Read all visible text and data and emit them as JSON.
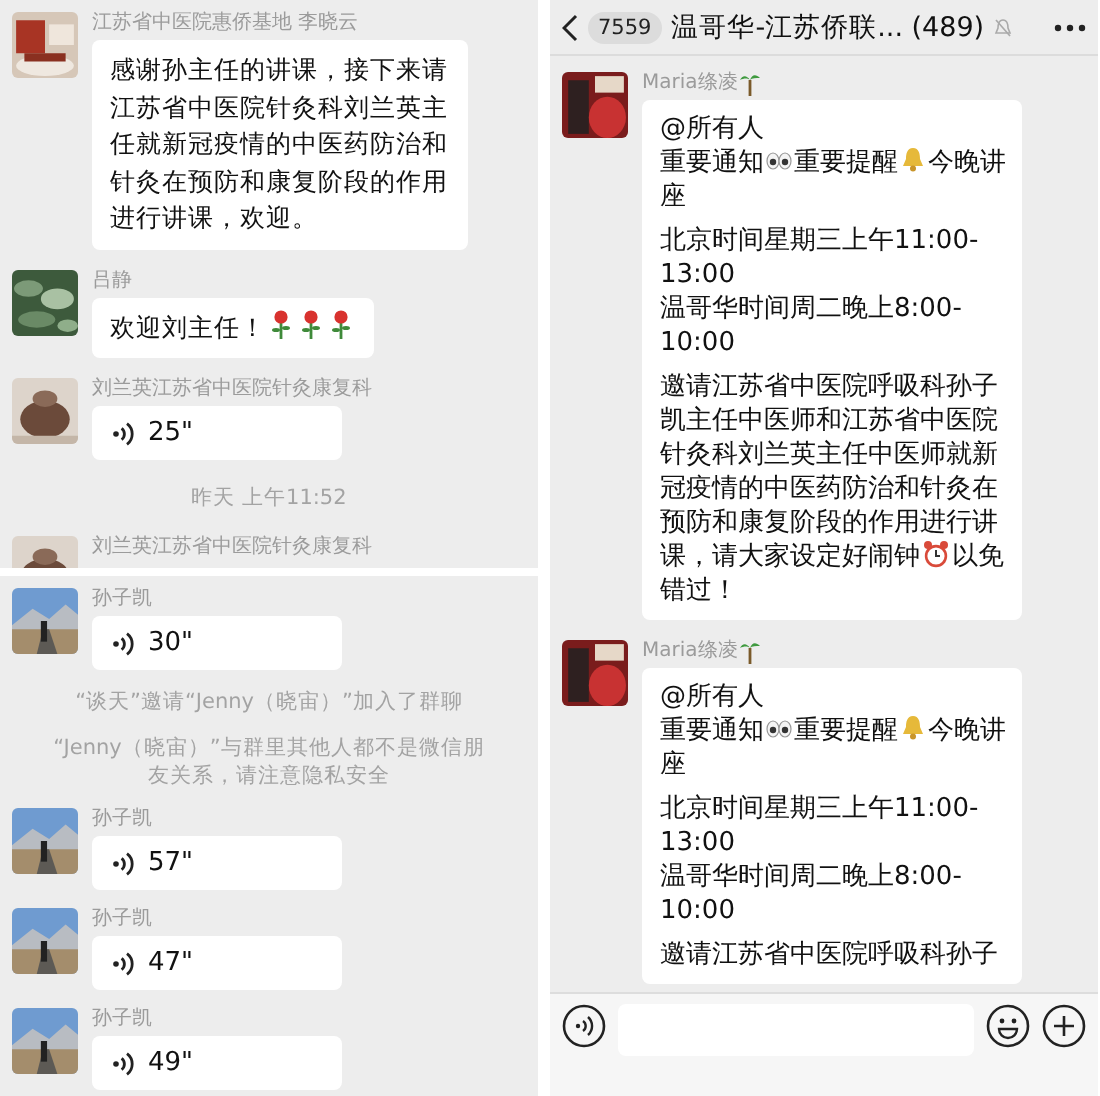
{
  "left_chat": {
    "sections": [
      {
        "items": [
          {
            "kind": "text",
            "sender": "江苏省中医院惠侨基地 李晓云",
            "avatar": {
              "kind": "picture"
            },
            "paragraphs": [
              [
                [
                  {
                    "kind": "text",
                    "text": "感谢孙主任的讲课，接下来请江苏省中医院针灸科刘兰英主任就新冠疫情的中医药防治和针灸在预防和康复阶段的作用进行讲课，欢迎。"
                  }
                ]
              ]
            ]
          },
          {
            "kind": "text",
            "sender": "吕静",
            "avatar": {
              "kind": "picture"
            },
            "paragraphs": [
              [
                [
                  {
                    "kind": "text",
                    "text": "欢迎刘主任！"
                  },
                  {
                    "kind": "rose"
                  },
                  {
                    "kind": "rose"
                  },
                  {
                    "kind": "rose"
                  }
                ]
              ]
            ]
          },
          {
            "kind": "voice",
            "sender": "刘兰英江苏省中医院针灸康复科",
            "avatar": {
              "kind": "picture"
            },
            "duration": "25\""
          },
          {
            "kind": "time",
            "text": "昨天 上午11:52"
          },
          {
            "kind": "cut",
            "sender": "刘兰英江苏省中医院针灸康复科",
            "avatar": {
              "kind": "picture"
            }
          }
        ]
      },
      {
        "items": [
          {
            "kind": "voice",
            "sender": "孙子凯",
            "avatar": {
              "kind": "picture"
            },
            "duration": "30\""
          },
          {
            "kind": "system",
            "text": "“谈天”邀请“Jenny（晓宙）”加入了群聊"
          },
          {
            "kind": "system",
            "text": "“Jenny（晓宙）”与群里其他人都不是微信朋友关系，请注意隐私安全"
          },
          {
            "kind": "voice",
            "sender": "孙子凯",
            "avatar": {
              "kind": "picture"
            },
            "duration": "57\""
          },
          {
            "kind": "voice",
            "sender": "孙子凯",
            "avatar": {
              "kind": "picture"
            },
            "duration": "47\""
          },
          {
            "kind": "voice",
            "sender": "孙子凯",
            "avatar": {
              "kind": "picture"
            },
            "duration": "49\""
          }
        ]
      }
    ]
  },
  "right_chat": {
    "header": {
      "unread": "7559",
      "title": "温哥华-江苏侨联... (489)",
      "muted": true
    },
    "messages": [
      {
        "kind": "text",
        "sender": "Maria绦凌",
        "sender_icon": {
          "kind": "palm"
        },
        "avatar": {
          "kind": "picture"
        },
        "paragraphs": [
          [
            [
              {
                "kind": "text",
                "text": "@所有人"
              }
            ],
            [
              {
                "kind": "text",
                "text": "重要通知"
              },
              {
                "kind": "eyes"
              },
              {
                "kind": "text",
                "text": "重要提醒"
              },
              {
                "kind": "bell"
              },
              {
                "kind": "text",
                "text": "今晚讲"
              }
            ],
            [
              {
                "kind": "text",
                "text": "座"
              }
            ]
          ],
          [
            [
              {
                "kind": "text",
                "text": "北京时间星期三上午11:00-"
              }
            ],
            [
              {
                "kind": "text",
                "text": "13:00"
              }
            ],
            [
              {
                "kind": "text",
                "text": "温哥华时间周二晚上8:00-"
              }
            ],
            [
              {
                "kind": "text",
                "text": "10:00"
              }
            ]
          ],
          [
            [
              {
                "kind": "text",
                "text": "邀请江苏省中医院呼吸科孙子"
              }
            ],
            [
              {
                "kind": "text",
                "text": "凯主任中医师和江苏省中医院"
              }
            ],
            [
              {
                "kind": "text",
                "text": "针灸科刘兰英主任中医师就新"
              }
            ],
            [
              {
                "kind": "text",
                "text": "冠疫情的中医药防治和针灸在"
              }
            ],
            [
              {
                "kind": "text",
                "text": "预防和康复阶段的作用进行讲"
              }
            ],
            [
              {
                "kind": "text",
                "text": "课，请大家设定好闹钟"
              },
              {
                "kind": "clock"
              },
              {
                "kind": "text",
                "text": "以免"
              }
            ],
            [
              {
                "kind": "text",
                "text": "错过！"
              }
            ]
          ]
        ]
      },
      {
        "kind": "text",
        "sender": "Maria绦凌",
        "sender_icon": {
          "kind": "palm"
        },
        "avatar": {
          "kind": "picture"
        },
        "paragraphs": [
          [
            [
              {
                "kind": "text",
                "text": "@所有人"
              }
            ],
            [
              {
                "kind": "text",
                "text": "重要通知"
              },
              {
                "kind": "eyes"
              },
              {
                "kind": "text",
                "text": "重要提醒"
              },
              {
                "kind": "bell"
              },
              {
                "kind": "text",
                "text": "今晚讲"
              }
            ],
            [
              {
                "kind": "text",
                "text": "座"
              }
            ]
          ],
          [
            [
              {
                "kind": "text",
                "text": "北京时间星期三上午11:00-"
              }
            ],
            [
              {
                "kind": "text",
                "text": "13:00"
              }
            ],
            [
              {
                "kind": "text",
                "text": "温哥华时间周二晚上8:00-"
              }
            ],
            [
              {
                "kind": "text",
                "text": "10:00"
              }
            ]
          ],
          [
            [
              {
                "kind": "text",
                "text": "邀请江苏省中医院呼吸科孙子"
              }
            ]
          ]
        ]
      }
    ]
  }
}
